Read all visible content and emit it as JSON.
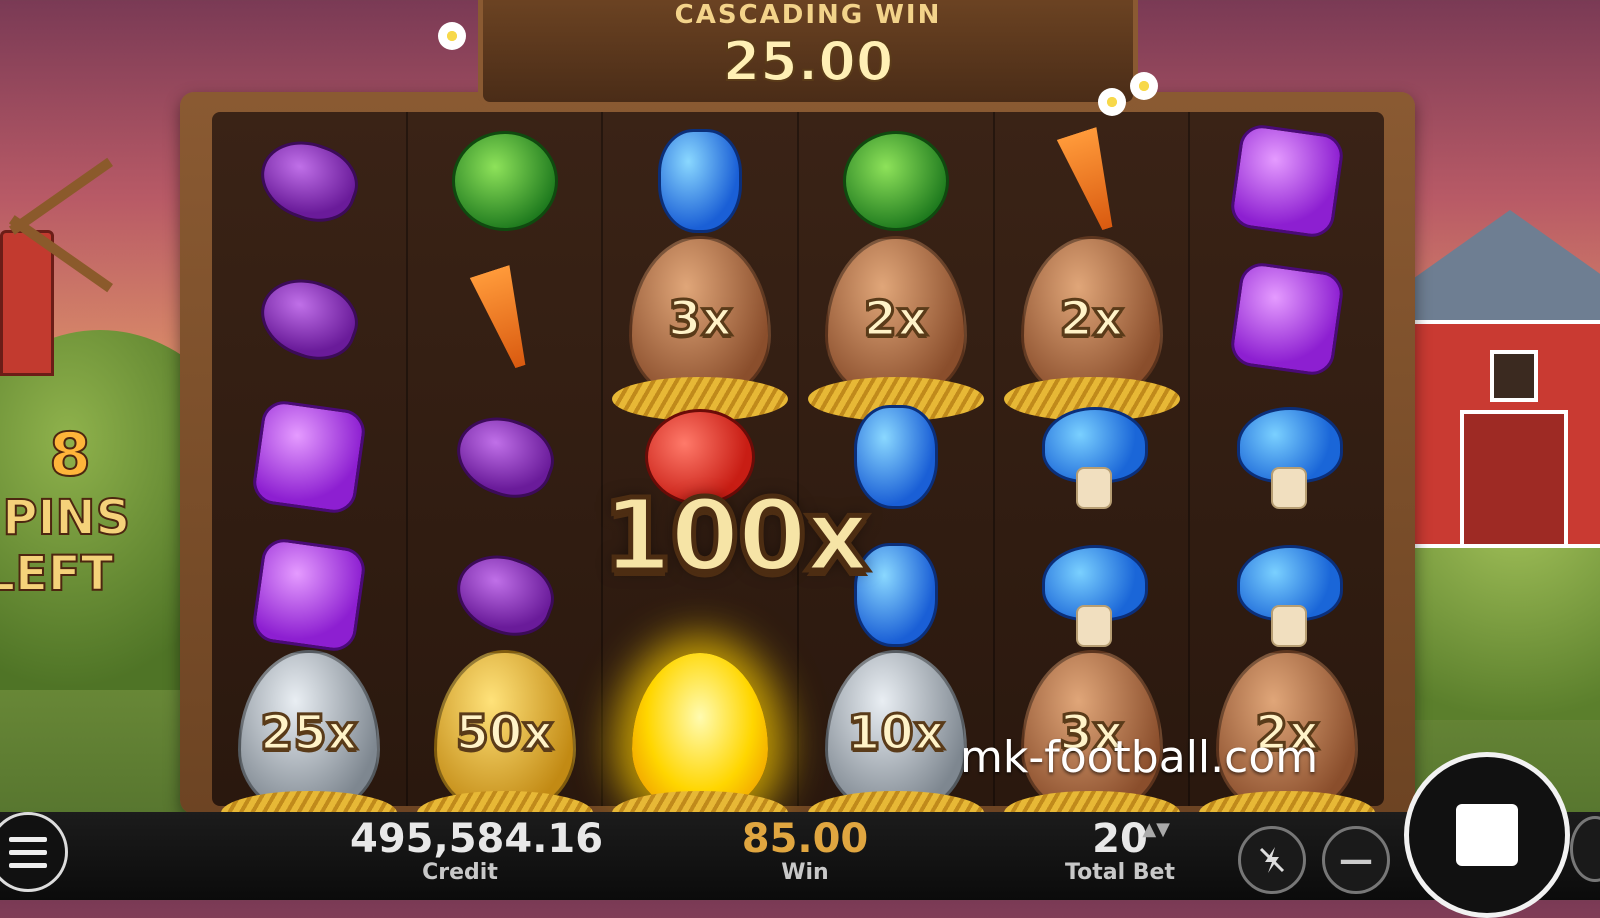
{
  "header": {
    "label": "CASCADING WIN",
    "amount": "25.00"
  },
  "free_spins": {
    "count": "8",
    "label_line1": "SPINS",
    "label_line2": "LEFT"
  },
  "big_multiplier": "100x",
  "reels": [
    [
      "eggplant",
      "eggplant",
      "gem-purple",
      "gem-purple",
      {
        "egg": "silver",
        "mult": "25x"
      }
    ],
    [
      "cabbage",
      "carrot",
      "eggplant",
      "eggplant",
      {
        "egg": "gold",
        "mult": "50x"
      }
    ],
    [
      "gem-blue",
      {
        "egg": "bronze",
        "mult": "3x"
      },
      "tomato",
      "",
      {
        "egg": "glow",
        "mult": ""
      }
    ],
    [
      "cabbage",
      {
        "egg": "bronze",
        "mult": "2x"
      },
      "gem-blue",
      "gem-blue",
      {
        "egg": "silver",
        "mult": "10x"
      }
    ],
    [
      "carrot",
      {
        "egg": "bronze",
        "mult": "2x"
      },
      "mushroom",
      "mushroom",
      {
        "egg": "bronze",
        "mult": "3x"
      }
    ],
    [
      "gem-purple",
      "gem-purple",
      "mushroom",
      "mushroom",
      {
        "egg": "bronze",
        "mult": "2x"
      }
    ]
  ],
  "status_bar": {
    "credit_value": "495,584.16",
    "credit_label": "Credit",
    "win_value": "85.00",
    "win_label": "Win",
    "bet_value": "20",
    "bet_label": "Total Bet",
    "bet_arrows": "▲▼",
    "turbo_icon": "turbo-icon",
    "minus_label": "—"
  },
  "watermark": "mk-football.com",
  "colors": {
    "win_accent": "#e0a640",
    "header_text": "#f3d38a"
  }
}
